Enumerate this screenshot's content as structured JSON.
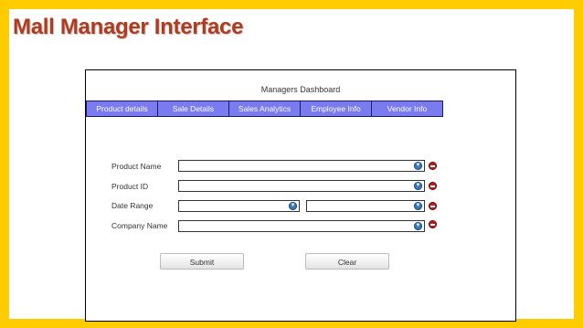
{
  "slide": {
    "title": "Mall Manager Interface"
  },
  "dashboard": {
    "title": "Managers Dashboard",
    "tabs": [
      {
        "label": "Product details"
      },
      {
        "label": "Sale Details"
      },
      {
        "label": "Sales Analytics"
      },
      {
        "label": "Employee Info"
      },
      {
        "label": "Vendor Info"
      }
    ],
    "form": {
      "product_name_label": "Product Name",
      "product_id_label": "Product ID",
      "date_range_label": "Date Range",
      "company_name_label": "Company Name"
    },
    "buttons": {
      "submit": "Submit",
      "clear": "Clear"
    }
  },
  "colors": {
    "background": "#FFCC00",
    "title": "#B23A1E",
    "tab_fill": "#7B7BF0",
    "dropdown_icon": "#3a78b8",
    "remove_icon": "#B82020"
  },
  "icons": {
    "dropdown": "chevron-down-circle-icon",
    "remove": "minus-circle-icon"
  }
}
